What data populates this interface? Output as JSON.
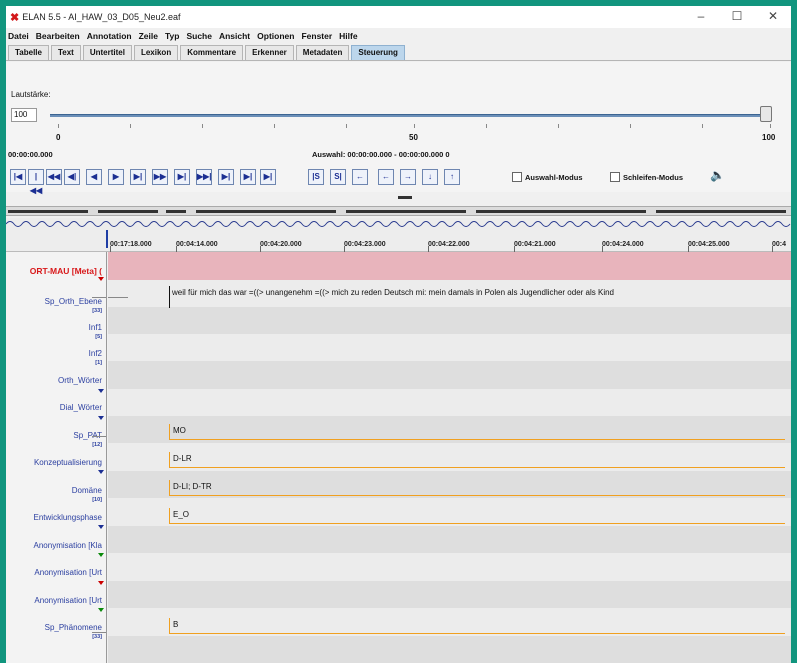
{
  "window": {
    "title": "ELAN 5.5 - AI_HAW_03_D05_Neu2.eaf",
    "controls": [
      "–",
      "☐",
      "✕"
    ]
  },
  "menu": [
    "Datei",
    "Bearbeiten",
    "Annotation",
    "Zeile",
    "Typ",
    "Suche",
    "Ansicht",
    "Optionen",
    "Fenster",
    "Hilfe"
  ],
  "tabs": [
    {
      "label": "Tabelle",
      "active": false
    },
    {
      "label": "Text",
      "active": false
    },
    {
      "label": "Untertitel",
      "active": false
    },
    {
      "label": "Lexikon",
      "active": false
    },
    {
      "label": "Kommentare",
      "active": false
    },
    {
      "label": "Erkenner",
      "active": false
    },
    {
      "label": "Metadaten",
      "active": false
    },
    {
      "label": "Steuerung",
      "active": true
    }
  ],
  "volume": {
    "label": "Lautstärke:",
    "value": "100",
    "level": 1.0,
    "scale_labels": [
      "0",
      "50",
      "100"
    ]
  },
  "time": {
    "current": "00:00:00.000",
    "selection": "Auswahl: 00:00:00.000 - 00:00:00.000  0"
  },
  "controls": {
    "buttons": [
      "|◀",
      "|◀◀",
      "◀◀",
      "◀|",
      "◀",
      "▶",
      "▶|",
      "▶▶",
      "▶|",
      "▶▶|",
      "▶|"
    ],
    "selection_buttons": [
      "|S",
      "S|",
      "←",
      "←",
      "→",
      "↓",
      "↑"
    ],
    "selection_mode_label": "Auswahl-Modus",
    "loop_mode_label": "Schleifen-Modus",
    "speaker_icon": "speaker-icon"
  },
  "ruler": {
    "labels": [
      "00:17:18.000",
      "00:04:14.000",
      "00:04:20.000",
      "00:04:23.000",
      "00:04:22.000",
      "00:04:21.000",
      "00:04:24.000",
      "00:04:25.000",
      "00:4"
    ]
  },
  "tiers": [
    {
      "name": "ORT-MAU [Meta] (",
      "sub": "",
      "style": "red"
    },
    {
      "name": "Sp_Orth_Ebene",
      "sub": "[33]",
      "style": "normal"
    },
    {
      "name": "Inf1",
      "sub": "[5]",
      "style": "normal"
    },
    {
      "name": "Inf2",
      "sub": "[1]",
      "style": "normal"
    },
    {
      "name": "Orth_Wörter",
      "sub": "",
      "style": "normal"
    },
    {
      "name": "Dial_Wörter",
      "sub": "",
      "style": "normal"
    },
    {
      "name": "Sp_PAT",
      "sub": "[12]",
      "style": "normal"
    },
    {
      "name": "Konzeptualisierung",
      "sub": "",
      "style": "normal"
    },
    {
      "name": "Domäne",
      "sub": "[10]",
      "style": "normal"
    },
    {
      "name": "Entwicklungsphase",
      "sub": "",
      "style": "normal"
    },
    {
      "name": "Anonymisation [Kla",
      "sub": "",
      "style": "normal"
    },
    {
      "name": "Anonymisation [Urt",
      "sub": "",
      "style": "normal"
    },
    {
      "name": "Anonymisation [Urt",
      "sub": "",
      "style": "normal"
    },
    {
      "name": "Sp_Phänomene",
      "sub": "[33]",
      "style": "normal"
    }
  ],
  "annotations": {
    "sp_orth": "weil für mich das war =((> unangenehm =((> mich zu reden Deutsch mi: mein damals in Polen als Jugendlicher oder als Kind",
    "sp_pat": "MO",
    "konzept": "D-LR",
    "domaene": "D-LI; D-TR",
    "entwicklung": "E_O",
    "phaenomene": "B"
  },
  "colors": {
    "accent_blue": "#1c2f93",
    "tier_red": "#d8181a",
    "annotation_orange": "#f0a020",
    "active_tab": "#bcd6ec",
    "frame": "#11957e"
  }
}
